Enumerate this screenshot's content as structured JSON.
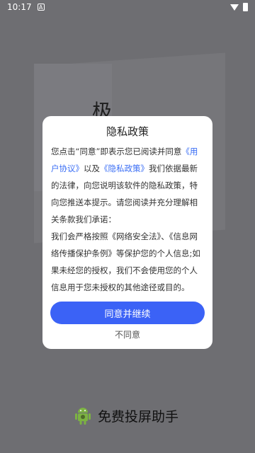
{
  "status": {
    "time": "10:17",
    "a_icon": "A",
    "icons": [
      "wifi-icon",
      "battery-icon"
    ]
  },
  "background": {
    "glyph": "极"
  },
  "dialog": {
    "title": "隐私政策",
    "p1_a": "您点击“同意”即表示您已阅读并同意",
    "link_user": "《用户协议》",
    "p1_b": "以及",
    "link_privacy": "《隐私政策》",
    "p1_c": "我们依据最新的法律，向您说明该软件的隐私政策，特向您推送本提示。请您阅读并充分理解相关条款我们承诺：",
    "p2": "我们会严格按照《网络安全法》、《信息网络传播保护条例》等保护您的个人信息;如果未经您的授权，我们不会使用您的个人信息用于您未授权的其他途径或目的。",
    "agree_label": "同意并继续",
    "disagree_label": "不同意"
  },
  "footer": {
    "app_name": "免费投屏助手",
    "icon": "android-icon"
  },
  "colors": {
    "accent": "#3b62f6",
    "link": "#3a6ef5",
    "overlay": "#6e6e72"
  }
}
